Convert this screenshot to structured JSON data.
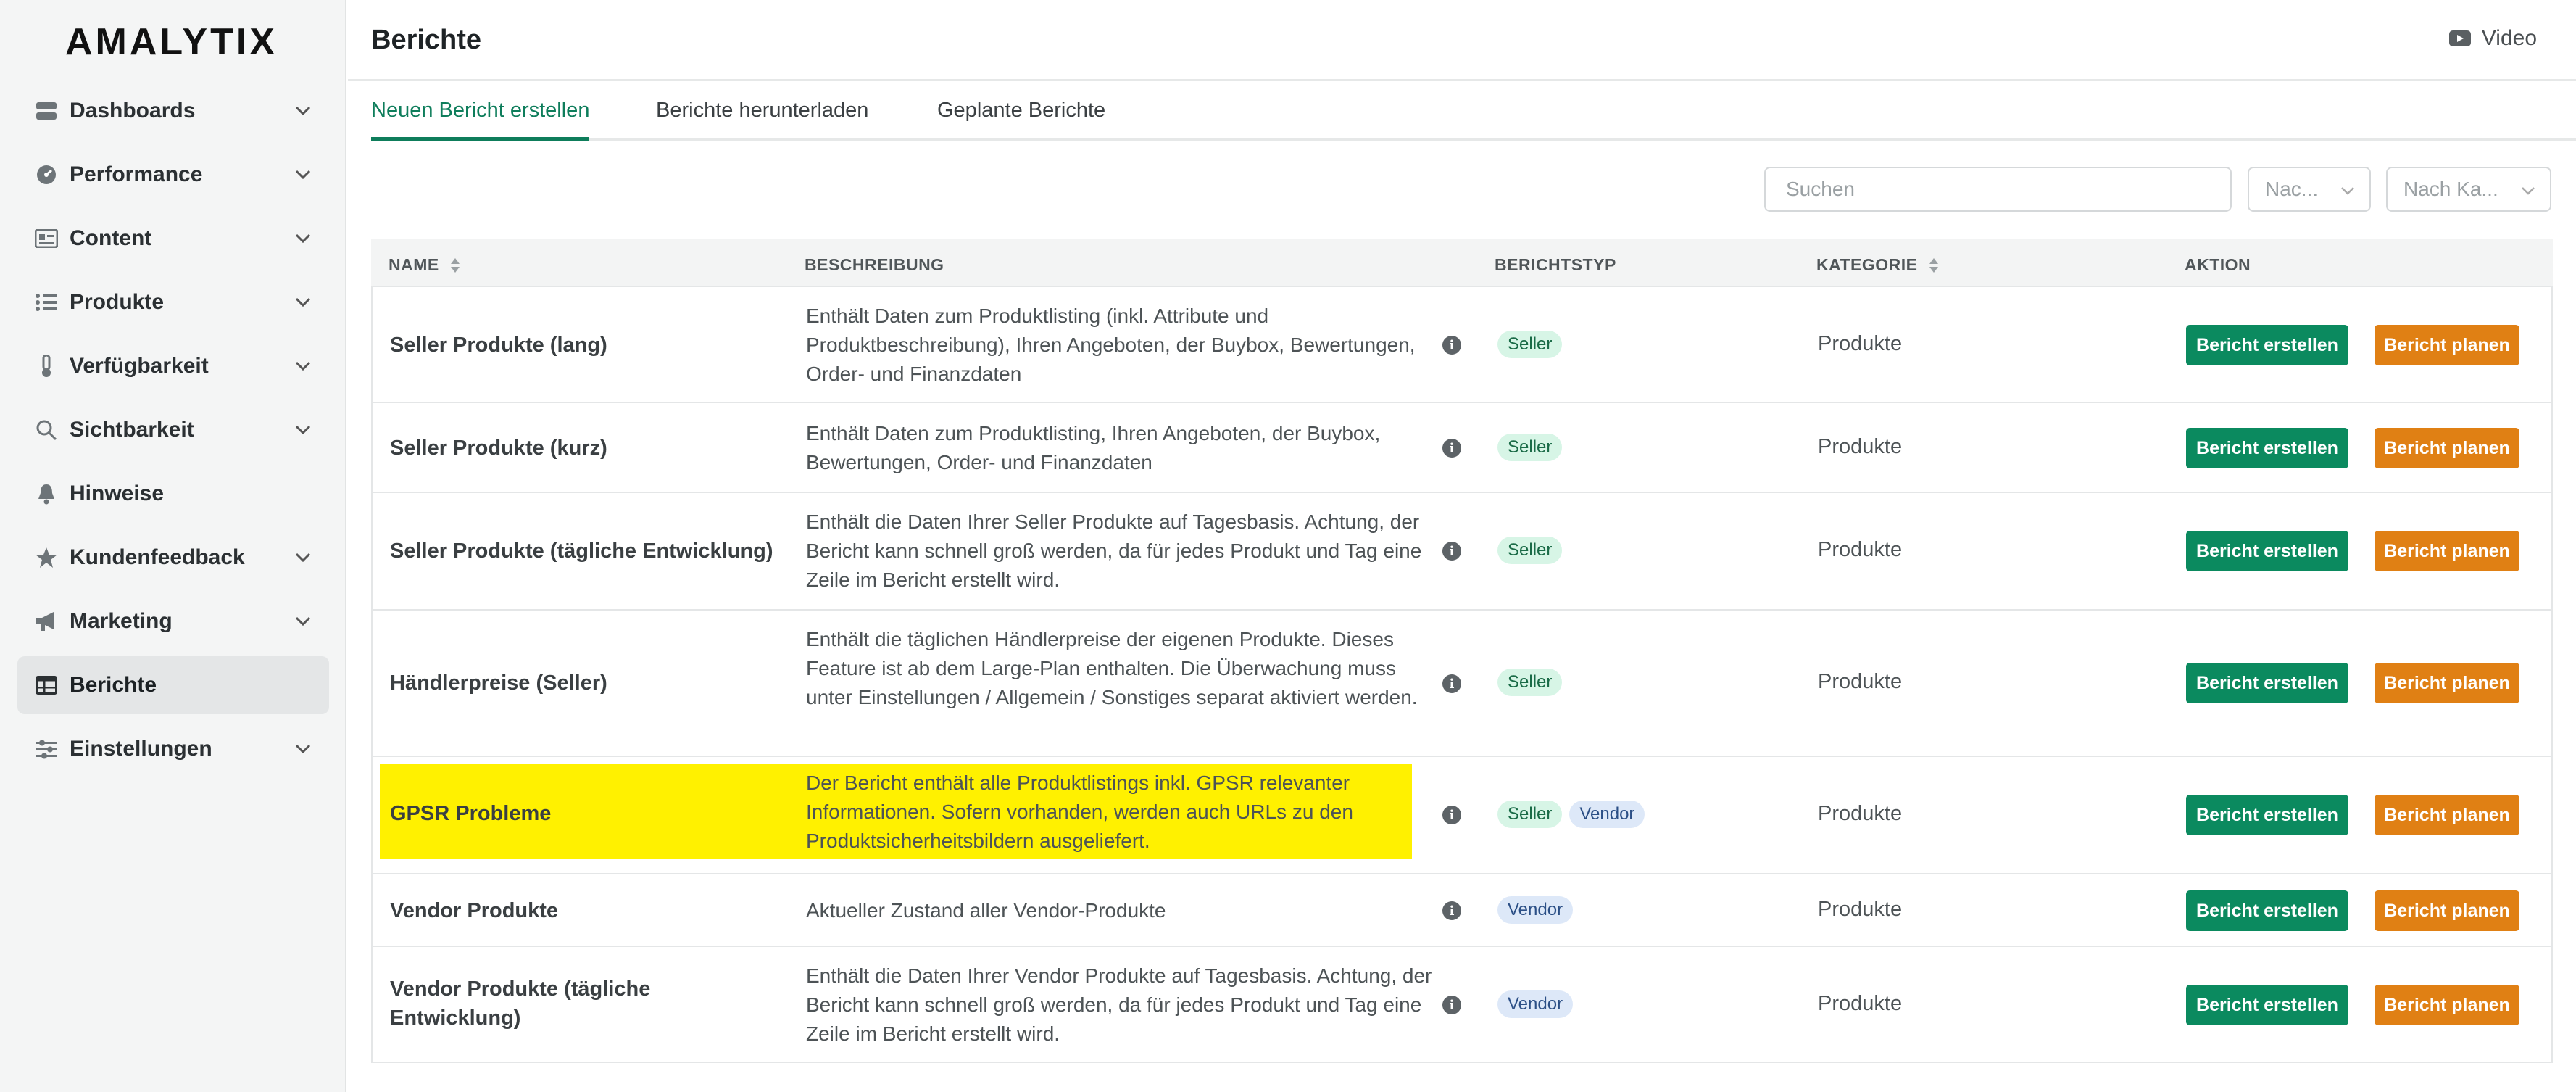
{
  "brand": {
    "logo_text": "AMALYTIX"
  },
  "sidebar": {
    "items": [
      {
        "label": "Dashboards",
        "icon": "dashboard-icon",
        "has_chevron": true
      },
      {
        "label": "Performance",
        "icon": "performance-icon",
        "has_chevron": true
      },
      {
        "label": "Content",
        "icon": "content-icon",
        "has_chevron": true
      },
      {
        "label": "Produkte",
        "icon": "list-icon",
        "has_chevron": true
      },
      {
        "label": "Verfügbarkeit",
        "icon": "thermometer-icon",
        "has_chevron": true
      },
      {
        "label": "Sichtbarkeit",
        "icon": "search-icon",
        "has_chevron": true
      },
      {
        "label": "Hinweise",
        "icon": "bell-icon",
        "has_chevron": false
      },
      {
        "label": "Kundenfeedback",
        "icon": "star-icon",
        "has_chevron": true
      },
      {
        "label": "Marketing",
        "icon": "megaphone-icon",
        "has_chevron": true
      },
      {
        "label": "Berichte",
        "icon": "table-icon",
        "has_chevron": false,
        "active": true
      },
      {
        "label": "Einstellungen",
        "icon": "sliders-icon",
        "has_chevron": true
      }
    ]
  },
  "header": {
    "title": "Berichte",
    "video_label": "Video"
  },
  "tabs": [
    {
      "label": "Neuen Bericht erstellen",
      "active": true
    },
    {
      "label": "Berichte herunterladen",
      "active": false
    },
    {
      "label": "Geplante Berichte",
      "active": false
    }
  ],
  "filters": {
    "search_placeholder": "Suchen",
    "select1": "Nac...",
    "select2": "Nach Ka..."
  },
  "table": {
    "columns": [
      "NAME",
      "BESCHREIBUNG",
      "BERICHTSTYP",
      "KATEGORIE",
      "AKTION"
    ],
    "create_label": "Bericht erstellen",
    "plan_label": "Bericht planen",
    "rows": [
      {
        "name": "Seller Produkte (lang)",
        "desc": "Enthält Daten zum Produktlisting (inkl. Attribute und Produktbeschreibung), Ihren Angeboten, der Buybox, Bewertungen, Order- und Finanzdaten",
        "types": [
          "Seller"
        ],
        "category": "Produkte"
      },
      {
        "name": "Seller Produkte (kurz)",
        "desc": "Enthält Daten zum Produktlisting, Ihren Angeboten, der Buybox, Bewertungen, Order- und Finanzdaten",
        "types": [
          "Seller"
        ],
        "category": "Produkte"
      },
      {
        "name": "Seller Produkte (tägliche Entwicklung)",
        "desc": "Enthält die Daten Ihrer Seller Produkte auf Tagesbasis. Achtung, der Bericht kann schnell groß werden, da für jedes Produkt und Tag eine Zeile im Bericht erstellt wird.",
        "types": [
          "Seller"
        ],
        "category": "Produkte"
      },
      {
        "name": "Händlerpreise (Seller)",
        "desc": "Enthält die täglichen Händlerpreise der eigenen Produkte. Dieses Feature ist ab dem Large-Plan enthalten. Die Überwachung muss unter Einstellungen / Allgemein / Sonstiges separat aktiviert werden.",
        "types": [
          "Seller"
        ],
        "category": "Produkte"
      },
      {
        "name": "GPSR Probleme",
        "desc": "Der Bericht enthält alle Produktlistings inkl. GPSR relevanter Informationen. Sofern vorhanden, werden auch URLs zu den Produktsicherheitsbildern ausgeliefert.",
        "types": [
          "Seller",
          "Vendor"
        ],
        "category": "Produkte",
        "highlighted": true
      },
      {
        "name": "Vendor Produkte",
        "desc": "Aktueller Zustand aller Vendor-Produkte",
        "types": [
          "Vendor"
        ],
        "category": "Produkte"
      },
      {
        "name": "Vendor Produkte (tägliche Entwicklung)",
        "desc": "Enthält die Daten Ihrer Vendor Produkte auf Tagesbasis. Achtung, der Bericht kann schnell groß werden, da für jedes Produkt und Tag eine Zeile im Bericht erstellt wird.",
        "types": [
          "Vendor"
        ],
        "category": "Produkte"
      }
    ]
  }
}
